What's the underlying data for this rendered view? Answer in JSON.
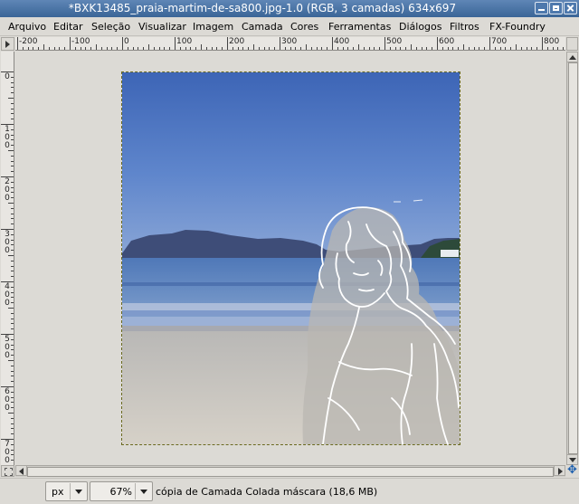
{
  "window": {
    "title": "*BXK13485_praia-martim-de-sa800.jpg-1.0 (RGB, 3 camadas) 634x697"
  },
  "menubar": {
    "items": [
      "Arquivo",
      "Editar",
      "Seleção",
      "Visualizar",
      "Imagem",
      "Camada",
      "Cores",
      "Ferramentas",
      "Diálogos",
      "Filtros",
      "FX-Foundry"
    ]
  },
  "rulers": {
    "horizontal_labels": [
      "-200",
      "-100",
      "0",
      "100",
      "200",
      "300",
      "400",
      "500",
      "600",
      "700",
      "800"
    ],
    "vertical_labels": [
      "0",
      "100",
      "200",
      "300",
      "400",
      "500",
      "600",
      "700"
    ]
  },
  "statusbar": {
    "unit": "px",
    "zoom": "67%",
    "message": "cópia de Camada Colada máscara (18,6 MB)"
  },
  "icons": {
    "navigate": "navigate-icon",
    "quick_mask": "quick-mask-icon",
    "ruler_menu": "triangle-right-icon"
  },
  "colors": {
    "titlebar": "#3a6597",
    "background": "#dcdad5",
    "sky_top": "#3f68b8",
    "sea": "#5a7fb8",
    "sand": "#cfc9bf"
  }
}
